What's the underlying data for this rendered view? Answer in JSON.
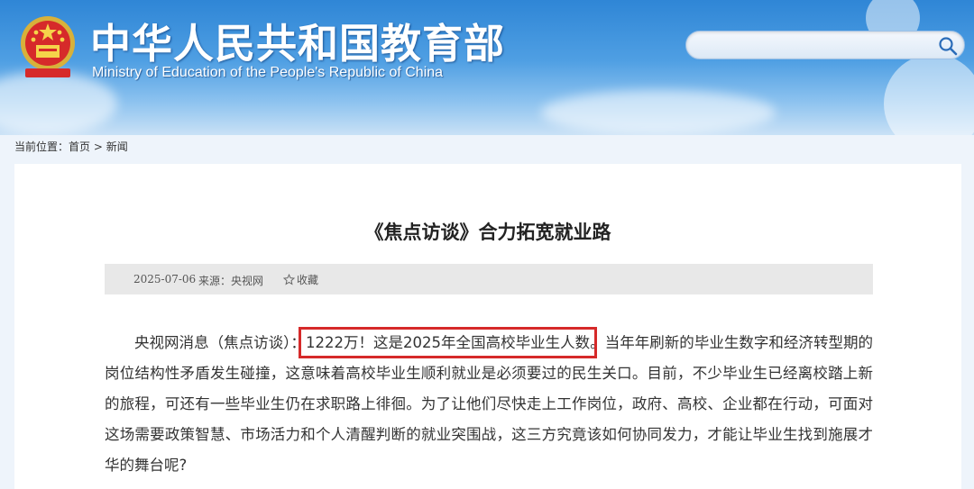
{
  "header": {
    "title_cn": "中华人民共和国教育部",
    "title_en": "Ministry of Education of the People's Republic of China",
    "search_placeholder": ""
  },
  "breadcrumb": {
    "label": "当前位置：",
    "home": "首页",
    "separator": ">",
    "current": "新闻"
  },
  "article": {
    "title": "《焦点访谈》合力拓宽就业路",
    "date": "2025-07-06",
    "source": "来源：央视网",
    "favorite_label": "收藏",
    "para_prefix": "央视网消息（焦点访谈）：",
    "para_highlight": "1222万！这是2025年全国高校毕业生人数",
    "para_rest": "。当年年刷新的毕业生数字和经济转型期的岗位结构性矛盾发生碰撞，这意味着高校毕业生顺利就业是必须要过的民生关口。目前，不少毕业生已经离校踏上新的旅程，可还有一些毕业生仍在求职路上徘徊。为了让他们尽快走上工作岗位，政府、高校、企业都在行动，可面对这场需要政策智慧、市场活力和个人清醒判断的就业突围战，这三方究竟该如何协同发力，才能让毕业生找到施展才华的舞台呢?"
  },
  "colors": {
    "header_blue": "#2f86d6",
    "highlight_red": "#d62a2a"
  },
  "icons": [
    "national-emblem-icon",
    "search-icon",
    "star-icon"
  ]
}
